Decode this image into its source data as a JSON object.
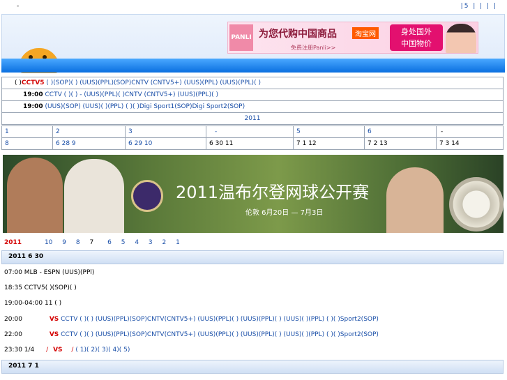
{
  "top": {
    "dash": "-",
    "right": "|5  |   |     |  |"
  },
  "ad": {
    "panli": "PANLI",
    "headline": "为您代购中国商品",
    "taobao": "淘宝网",
    "register": "免费注册Panli>>",
    "box_line1": "身处国外",
    "box_line2": "中国物价"
  },
  "schedule": [
    {
      "pre": "(  )",
      "channel": "CCTV5",
      "links": "  (  )(SOP)(  )        (UUS)(PPL)(SOP)CNTV (CNTV5+)    (UUS)(PPL)   (UUS)(PPL)(  )"
    },
    {
      "pre": "19:00",
      "channel": "",
      "links": "  CCTV ( )(  )    -    (UUS)(PPL)(  )CNTV (CNTV5+)    (UUS)(PPL)(  )"
    },
    {
      "pre": "19:00",
      "channel": "",
      "links": "    (UUS)(SOP)    (UUS)(  )(PPL)    (  )(  )Digi Sport1(SOP)Digi Sport2(SOP)"
    }
  ],
  "year_cell": "2011",
  "days": [
    [
      "1",
      "2",
      "3",
      "-",
      "5",
      "6",
      "  -"
    ],
    [
      "8",
      "6 28 9",
      "6 29 10",
      "6 30 11",
      "7 1 12",
      "7 2 13",
      "7 3 14"
    ]
  ],
  "banner": {
    "title": "2011温布尔登网球公开赛",
    "sub": "伦敦  6月20日 — 7月3日"
  },
  "nav": {
    "year": "2011",
    "nums": [
      "10",
      "9",
      "8",
      "7",
      "6",
      "5",
      "4",
      "3",
      "2",
      "1"
    ]
  },
  "day1": "2011  6  30",
  "events": [
    "07:00 MLB   -    ESPN (UUS)(PPl)",
    "18:35     CCTV5(  )(SOP)(  )",
    "19:00-04:00   11      (  )",
    "20:00",
    "22:00",
    "23:30     1/4"
  ],
  "ev4": {
    "vs": "VS",
    "rest": "   CCTV ( )(  )    (UUS)(PPL)(SOP)CNTV(CNTV5+)     (UUS)(PPL)(  )     (UUS)(PPL)(  )     (UUS)(  )(PPL)    (  )(  )Sport2(SOP)"
  },
  "ev5": {
    "vs": "VS",
    "rest": "   CCTV ( )(  )    (UUS)(PPL)(SOP)CNTV(CNTV5+)     (UUS)(PPL)(  )     (UUS)(PPL)(  )     (UUS)(  )(PPL)    (  )(  )Sport2(SOP)"
  },
  "ev6": {
    "slash1": "/",
    "vs": "VS",
    "slash2": "/",
    "rest": "          (  1)(  2)(  3)(  4)(  5)"
  },
  "day2": "2011  7  1"
}
